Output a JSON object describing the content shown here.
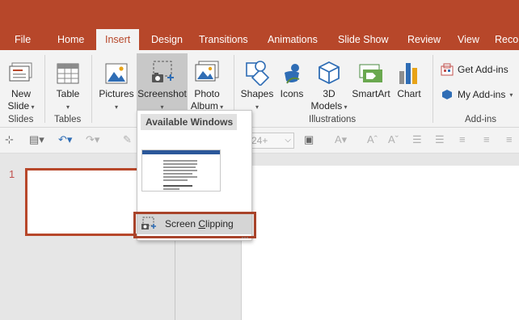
{
  "tabs": [
    {
      "label": "File",
      "name": "tab-file"
    },
    {
      "label": "Home",
      "name": "tab-home"
    },
    {
      "label": "Insert",
      "name": "tab-insert",
      "active": true
    },
    {
      "label": "Design",
      "name": "tab-design"
    },
    {
      "label": "Transitions",
      "name": "tab-transitions"
    },
    {
      "label": "Animations",
      "name": "tab-animations"
    },
    {
      "label": "Slide Show",
      "name": "tab-slide-show"
    },
    {
      "label": "Review",
      "name": "tab-review"
    },
    {
      "label": "View",
      "name": "tab-view"
    },
    {
      "label": "Reco",
      "name": "tab-record"
    }
  ],
  "ribbon": {
    "slides": {
      "new_slide_1": "New",
      "new_slide_2": "Slide",
      "group": "Slides"
    },
    "tables": {
      "table": "Table",
      "group": "Tables"
    },
    "images": {
      "pictures": "Pictures",
      "screenshot": "Screenshot",
      "photo_album_1": "Photo",
      "photo_album_2": "Album"
    },
    "illustrations": {
      "shapes": "Shapes",
      "icons": "Icons",
      "models_1": "3D",
      "models_2": "Models",
      "smartart": "SmartArt",
      "chart": "Chart",
      "group": "Illustrations"
    },
    "addins": {
      "get": "Get Add-ins",
      "my": "My Add-ins",
      "group": "Add-ins"
    }
  },
  "toolbar": {
    "font_size": "24+"
  },
  "slides_pane": {
    "slide_number": "1"
  },
  "screenshot_menu": {
    "header": "Available Windows",
    "clipping_pre": "Screen ",
    "clipping_key": "C",
    "clipping_post": "lipping"
  },
  "colors": {
    "accent": "#b7472a",
    "ribbon_bg": "#f3f3f3",
    "highlight": "#a8432a"
  }
}
